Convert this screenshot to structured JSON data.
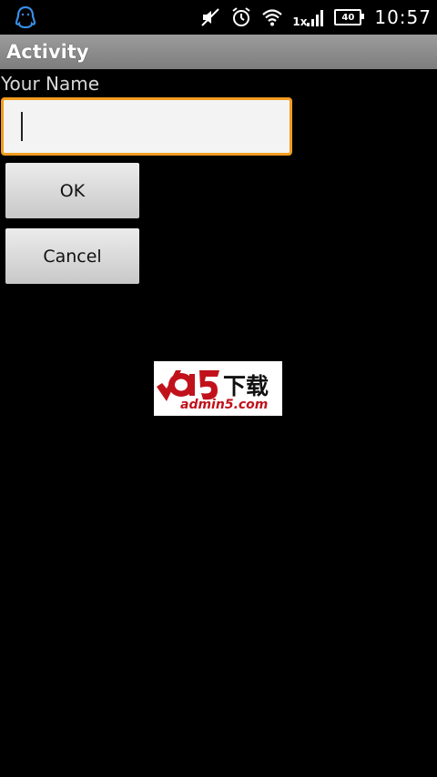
{
  "status_bar": {
    "time": "10:57",
    "battery_level": "40",
    "signal_label": "1x",
    "icons": {
      "app": "qq-penguin-icon",
      "mute": "muted-icon",
      "alarm": "alarm-icon",
      "wifi": "wifi-icon",
      "signal": "signal-icon"
    }
  },
  "title_bar": {
    "title": "Activity"
  },
  "form": {
    "name_label": "Your Name",
    "name_value": "",
    "ok_label": "OK",
    "cancel_label": "Cancel"
  },
  "watermark": {
    "brand": "a5",
    "main": "下载",
    "sub": "admin5.com"
  },
  "colors": {
    "input_focus_border": "#f39c1f",
    "title_bar_top": "#9c9c9c",
    "title_bar_bottom": "#7d7d7d",
    "logo_red": "#c1121c"
  }
}
